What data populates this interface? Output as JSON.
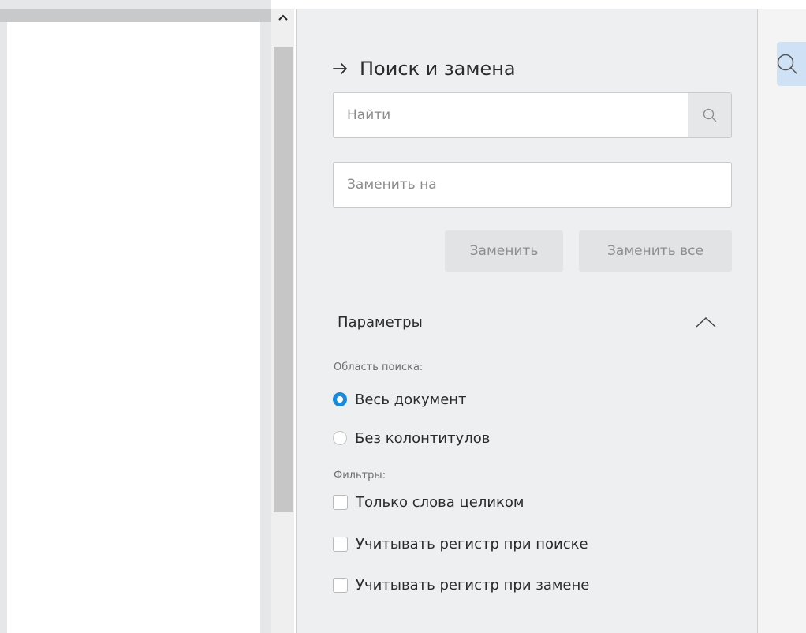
{
  "panel": {
    "title": "Поиск и замена",
    "back_icon": "arrow-right-icon",
    "find": {
      "placeholder": "Найти",
      "value": "",
      "icon": "search-icon"
    },
    "replace": {
      "placeholder": "Заменить на",
      "value": ""
    },
    "buttons": {
      "replace": "Заменить",
      "replace_all": "Заменить все"
    },
    "params": {
      "title": "Параметры",
      "collapse_icon": "chevron-up-icon",
      "scope": {
        "label": "Область поиска:",
        "options": [
          {
            "label": "Весь документ",
            "selected": true
          },
          {
            "label": "Без колонтитулов",
            "selected": false
          }
        ]
      },
      "filters": {
        "label": "Фильтры:",
        "options": [
          {
            "label": "Только слова целиком",
            "checked": false
          },
          {
            "label": "Учитывать регистр при поиске",
            "checked": false
          },
          {
            "label": "Учитывать регистр при замене",
            "checked": false
          }
        ]
      }
    }
  },
  "rail": {
    "search_icon": "search-icon",
    "active": true
  },
  "colors": {
    "accent": "#1a8bdb",
    "rail_active_bg": "#cfe2f5",
    "panel_bg": "#eeeff1"
  }
}
